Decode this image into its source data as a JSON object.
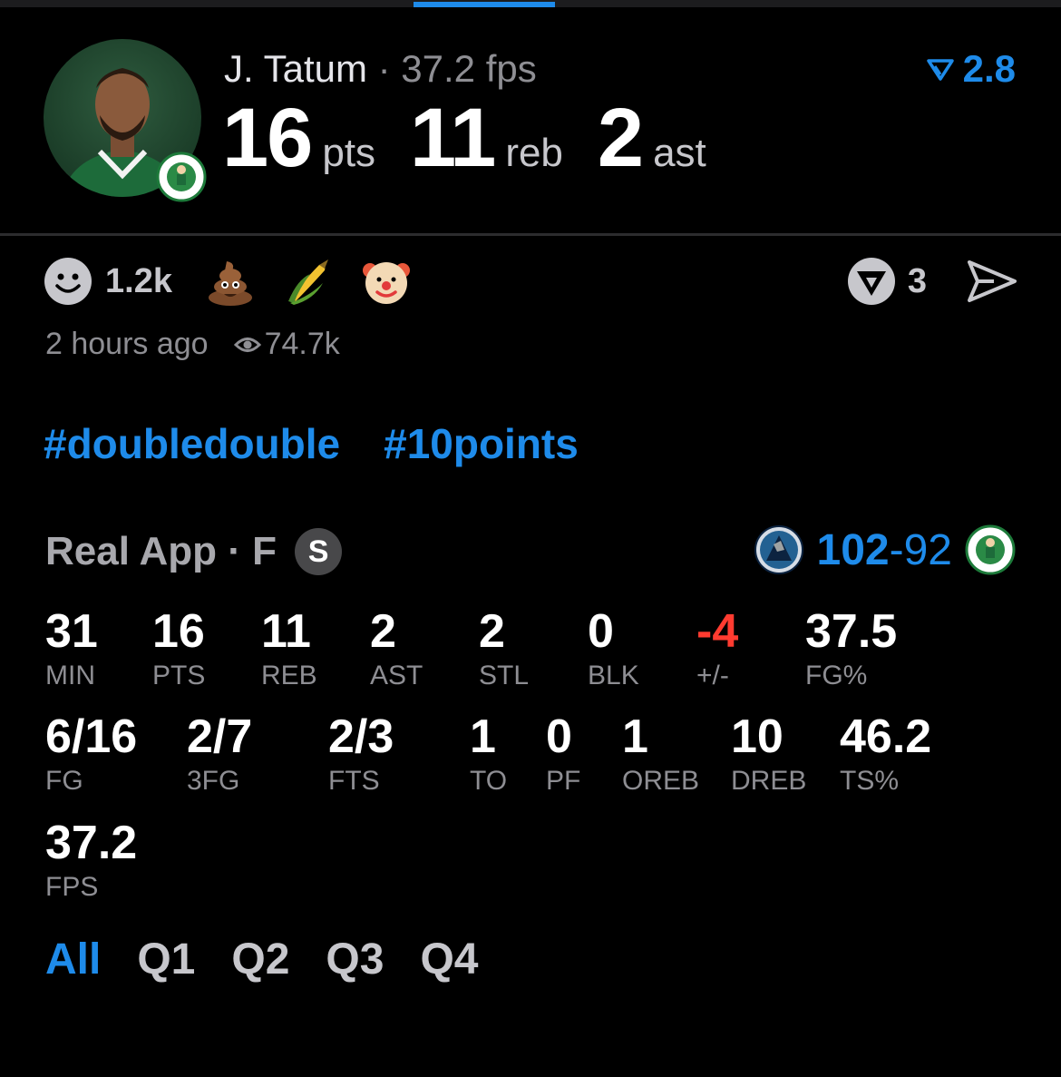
{
  "player": {
    "name": "J. Tatum",
    "separator": "·",
    "fps": "37.2 fps",
    "rating": "2.8",
    "points": "16",
    "points_unit": "pts",
    "rebounds": "11",
    "rebounds_unit": "reb",
    "assists": "2",
    "assists_unit": "ast"
  },
  "social": {
    "reaction_count": "1.2k",
    "emojis": [
      "poop-emoji",
      "corn-emoji",
      "clown-emoji"
    ],
    "v_count": "3",
    "time_ago": "2 hours ago",
    "views": "74.7k"
  },
  "hashtags": [
    "#doubledouble",
    "#10points"
  ],
  "game": {
    "source": "Real App · F",
    "badge": "S",
    "home_score": "102",
    "dash": "-",
    "away_score": "92"
  },
  "stats": [
    {
      "value": "31",
      "label": "MIN"
    },
    {
      "value": "16",
      "label": "PTS"
    },
    {
      "value": "11",
      "label": "REB"
    },
    {
      "value": "2",
      "label": "AST"
    },
    {
      "value": "2",
      "label": "STL"
    },
    {
      "value": "0",
      "label": "BLK"
    },
    {
      "value": "-4",
      "label": "+/-"
    },
    {
      "value": "37.5",
      "label": "FG%"
    },
    {
      "value": "6/16",
      "label": "FG"
    },
    {
      "value": "2/7",
      "label": "3FG"
    },
    {
      "value": "2/3",
      "label": "FTS"
    },
    {
      "value": "1",
      "label": "TO"
    },
    {
      "value": "0",
      "label": "PF"
    },
    {
      "value": "1",
      "label": "OREB"
    },
    {
      "value": "10",
      "label": "DREB"
    },
    {
      "value": "46.2",
      "label": "TS%"
    },
    {
      "value": "37.2",
      "label": "FPS"
    }
  ],
  "quarters": [
    "All",
    "Q1",
    "Q2",
    "Q3",
    "Q4"
  ],
  "colors": {
    "accent": "#1e8bea",
    "negative": "#ff3b30",
    "muted": "#8e8e93",
    "background": "#000000"
  }
}
